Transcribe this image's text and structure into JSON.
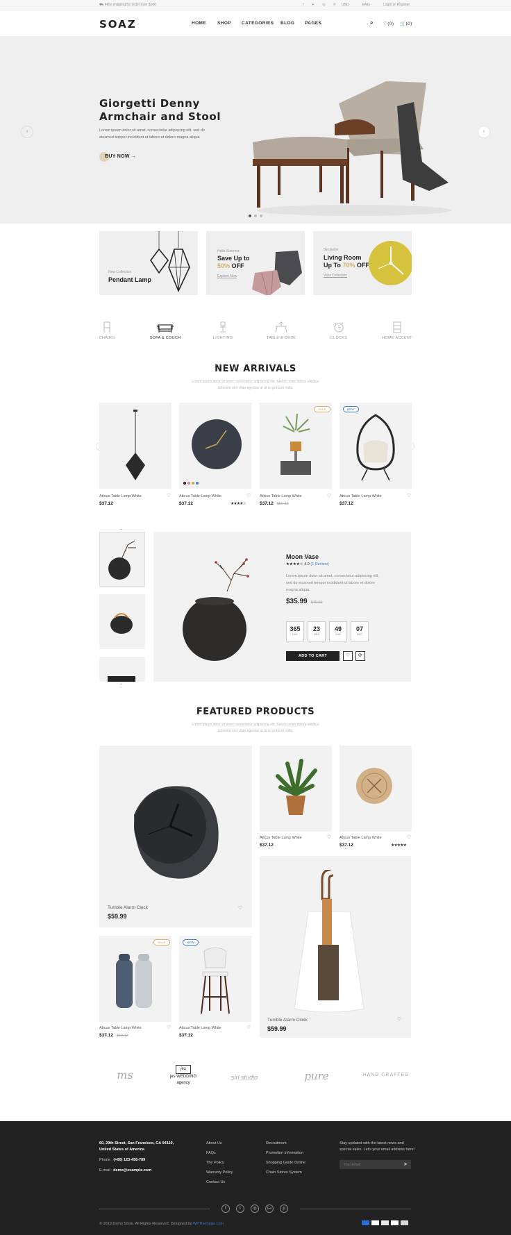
{
  "topbar": {
    "promo": "Free shipping for order over $100",
    "currency": "USD",
    "language": "ENG",
    "account": "Login or Register"
  },
  "nav": {
    "logo": "SOAZ",
    "items": [
      "HOME",
      "SHOP",
      "CATEGORIES",
      "BLOG",
      "PAGES"
    ],
    "wishlist": "(0)",
    "cart": "(0)"
  },
  "hero": {
    "title_line1": "Giorgetti Denny",
    "title_line2": "Armchair and Stool",
    "text_line1": "Lorem ipsum dolor sit amet, consectetur adipiscing elit, sed do",
    "text_line2": "eiusmod tempor incididunt ut labore et dolore magna aliqua",
    "cta": "BUY NOW"
  },
  "banners": [
    {
      "eyebrow": "New Collection",
      "title": "Pendant Lamp"
    },
    {
      "eyebrow": "Hello Summer",
      "title_a": "Save Up to",
      "highlight": "50%",
      "title_b": "OFF",
      "link": "Explore Now"
    },
    {
      "eyebrow": "Bestseller",
      "title_a": "Living Room",
      "title_b": "Up To",
      "highlight": "70%",
      "title_c": "OFF",
      "link": "View Collection"
    }
  ],
  "categories": [
    "CHAIRS",
    "SOFA & COUCH",
    "LIGHTING",
    "TABLE & DESK",
    "CLOCKS",
    "HOME ACCENT"
  ],
  "new_arrivals": {
    "title": "NEW ARRIVALS",
    "sub_line1": "Lorem ipsum dolor sit amet consectetur adipiscing elit. Sed do enim dolore elisibus",
    "sub_line2": "dolomite olor vitae egestas ut ut ac pretium nulla.",
    "products": [
      {
        "name": "Attcus Table Lamp White",
        "price": "$37.12"
      },
      {
        "name": "Attcus Table Lamp White",
        "price": "$37.12",
        "rating": "★★★★☆"
      },
      {
        "name": "Attcus Table Lamp White",
        "price": "$37.12",
        "old_price": "$50.12",
        "badge": "SALE"
      },
      {
        "name": "Attcus Table Lamp White",
        "price": "$37.12",
        "badge": "NEW"
      }
    ]
  },
  "deal": {
    "name": "Moon Vase",
    "stars": "★★★★☆",
    "rating": "4.0",
    "reviews": "(1 Review)",
    "desc_line1": "Lorem ipsum dolor sit amet, consectetur adipiscing elit,",
    "desc_line2": "sed do eiusmod tempor incididunt ut labore et dolore",
    "desc_line3": "magna aliqua.",
    "price": "$35.99",
    "old_price": "$49.99",
    "countdown": [
      {
        "num": "365",
        "unit": "DAY"
      },
      {
        "num": "23",
        "unit": "HRS"
      },
      {
        "num": "49",
        "unit": "MIN"
      },
      {
        "num": "07",
        "unit": "SEC"
      }
    ],
    "add_to_cart": "ADD TO CART"
  },
  "featured": {
    "title": "FEATURED PRODUCTS",
    "sub_line1": "Lorem ipsum dolor sit amet consectetur adipiscing elit. Sed do enim dolore elisibus",
    "sub_line2": "dolomite olor vitae egestas ut ut ac pretium nulla.",
    "big1": {
      "name": "Tumble Alarm Clock",
      "price": "$59.99"
    },
    "small": [
      {
        "name": "Attcus Table Lamp White",
        "price": "$37.12"
      },
      {
        "name": "Attcus Table Lamp White",
        "price": "$37.12",
        "rating": "★★★★★"
      },
      {
        "name": "Attcus Table Lamp White",
        "price": "$37.12",
        "old_price": "$50.12",
        "badge": "SALE"
      },
      {
        "name": "Attcus Table Lamp White",
        "price": "$37.12",
        "badge": "NEW"
      }
    ],
    "big2": {
      "name": "Tumble Alarm Clock",
      "price": "$59.99"
    }
  },
  "brands": [
    "ms",
    "jes WEDDING agency",
    "sirl studio",
    "pure",
    "HAND CRAFTED"
  ],
  "footer": {
    "address_line1": "60, 29th Street, San Francisco, CA 94110,",
    "address_line2": "United States of America",
    "phone_label": "Phone :",
    "phone": "(+00) 123-456-789",
    "email_label": "E-mail :",
    "email": "demo@example.com",
    "col1": [
      "About Us",
      "FAQs",
      "The Policy",
      "Warranty Policy",
      "Contact Us"
    ],
    "col2": [
      "Recruitment",
      "Promotion Information",
      "Shopping Guide Online",
      "Chain Stores System"
    ],
    "newsletter_line1": "Stay updated with the latest news and",
    "newsletter_line2": "special sales. Let's your email address here!",
    "email_placeholder": "Your Email",
    "copyright": "© 2019 Demo Store. All Rights Reserved. Designed by",
    "designer": "WPThemego.com"
  },
  "colors": {
    "accent": "#d4b06a",
    "dark": "#222222",
    "light_bg": "#efefef",
    "footer_bg": "#222222",
    "link_blue": "#3a7bd5"
  }
}
